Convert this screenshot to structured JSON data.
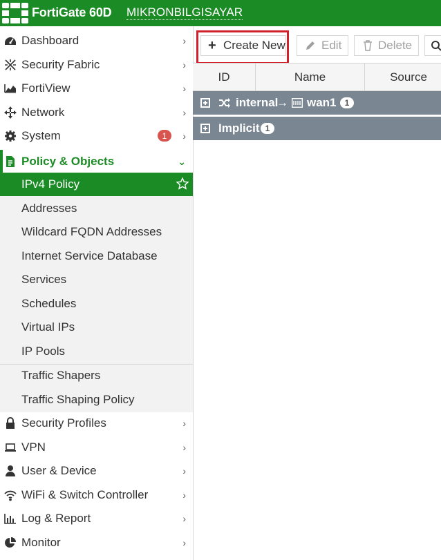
{
  "header": {
    "product": "FortiGate 60D",
    "hostname": "MIKRONBILGISAYAR"
  },
  "sidebar": {
    "items": [
      {
        "label": "Dashboard",
        "icon": "dashboard-icon"
      },
      {
        "label": "Security Fabric",
        "icon": "security-fabric-icon"
      },
      {
        "label": "FortiView",
        "icon": "fortiview-icon"
      },
      {
        "label": "Network",
        "icon": "network-icon"
      },
      {
        "label": "System",
        "icon": "gear-icon",
        "badge": "1"
      },
      {
        "label": "Policy & Objects",
        "icon": "policy-icon"
      }
    ],
    "subitems": [
      "IPv4 Policy",
      "Addresses",
      "Wildcard FQDN Addresses",
      "Internet Service Database",
      "Services",
      "Schedules",
      "Virtual IPs",
      "IP Pools",
      "Traffic Shapers",
      "Traffic Shaping Policy"
    ],
    "bottom_items": [
      {
        "label": "Security Profiles",
        "icon": "lock-icon"
      },
      {
        "label": "VPN",
        "icon": "laptop-icon"
      },
      {
        "label": "User & Device",
        "icon": "user-icon"
      },
      {
        "label": "WiFi & Switch Controller",
        "icon": "wifi-icon"
      },
      {
        "label": "Log & Report",
        "icon": "bar-chart-icon"
      },
      {
        "label": "Monitor",
        "icon": "pie-chart-icon"
      }
    ]
  },
  "toolbar": {
    "create_new": "Create New",
    "edit": "Edit",
    "delete": "Delete"
  },
  "table": {
    "columns": [
      "ID",
      "Name",
      "Source"
    ],
    "groups": [
      {
        "from": "internal",
        "arrow": "→",
        "to": "wan1",
        "count": "1"
      },
      {
        "label": "Implicit",
        "count": "1"
      }
    ]
  },
  "colors": {
    "brand_green": "#1b8b25",
    "group_row": "#7a8792",
    "highlight": "#d0202b",
    "badge_red": "#d9534f"
  }
}
